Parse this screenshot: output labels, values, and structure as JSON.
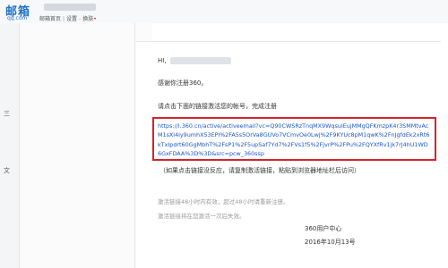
{
  "header": {
    "logo": "邮箱",
    "logo_sub": "qq.com",
    "nav": [
      "邮箱首页",
      "设置",
      "换肤"
    ]
  },
  "sidebar": {
    "items": [
      "三",
      "文"
    ]
  },
  "email": {
    "greeting": "HI,",
    "thanks": "感谢你注册360。",
    "instruction": "请点击下面的链接激活您的帐号，完成注册",
    "activation_link": "https://i.360.cn/active/activeemail?vc=Q90CWSRzTnqMX9WqsuIEujMMgQFKmzpK4r3SMMtvAcM1sXl4iy9umhX53EPi%2FA5s5OrVa8GUVo7VCmvOe0Lwj%2F9KYUc8pM1qwK%2FnJgfdEk2xRt6kTxIpdrt60GgMbhT%2FsP1%2F5upSaf7Yd7%2FVs1f5%2FjvrP%2FPu%2FQYXfRv1jk7rJ4hU1WD6GxFDAA%3D%3D&src=pcw_360ssp",
    "fallback_note": "（如果点击链接没反应，请复制激活链接，粘贴到浏览器地址栏后访问）",
    "expiry_note_1": "激活链接48小时内有效，超过48小时请重新注册。",
    "expiry_note_2": "激活链接将在您激活一次后失效。",
    "signature": "360用户中心",
    "date": "2016年10月13号"
  }
}
